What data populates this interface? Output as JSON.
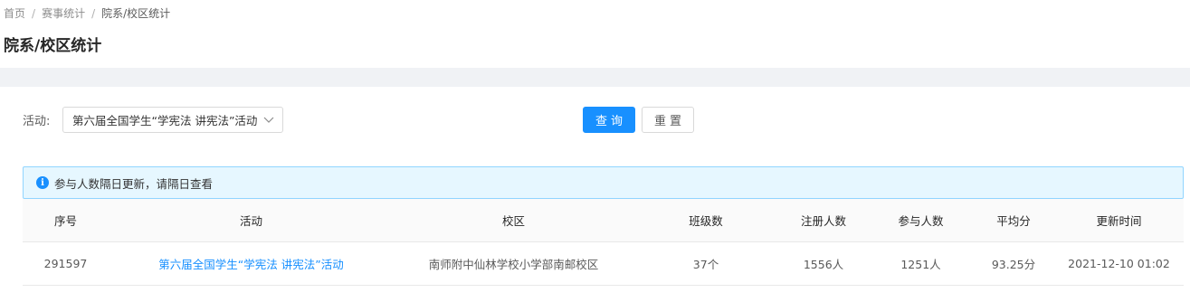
{
  "breadcrumb": {
    "items": [
      "首页",
      "赛事统计"
    ],
    "separator": "/",
    "current": "院系/校区统计"
  },
  "page": {
    "title": "院系/校区统计"
  },
  "filter": {
    "activity_label": "活动:",
    "activity_selected": "第六届全国学生“学宪法 讲宪法”活动",
    "query_button": "查询",
    "reset_button": "重置"
  },
  "alert": {
    "icon": "info-icon",
    "text": "参与人数隔日更新，请隔日查看"
  },
  "table": {
    "columns": [
      "序号",
      "活动",
      "校区",
      "班级数",
      "注册人数",
      "参与人数",
      "平均分",
      "更新时间"
    ],
    "rows": [
      [
        "291597",
        "第六届全国学生“学宪法 讲宪法”活动",
        "南师附中仙林学校小学部南邮校区",
        "37个",
        "1556人",
        "1251人",
        "93.25分",
        "2021-12-10 01:02"
      ]
    ]
  },
  "colors": {
    "primary": "#1890ff",
    "alert_bg": "#e6f7ff",
    "alert_border": "#91d5ff",
    "gap_bg": "#f0f2f5"
  }
}
